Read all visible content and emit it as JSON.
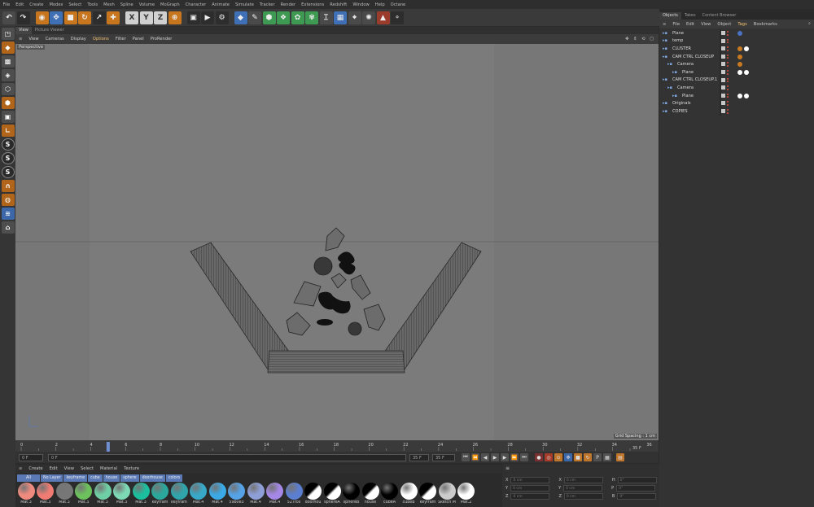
{
  "menubar": [
    "File",
    "Edit",
    "Create",
    "Modes",
    "Select",
    "Tools",
    "Mesh",
    "Spline",
    "Volume",
    "MoGraph",
    "Character",
    "Animate",
    "Simulate",
    "Tracker",
    "Render",
    "Extensions",
    "Redshift",
    "Window",
    "Help",
    "Octane"
  ],
  "view_tabs": [
    "View",
    "Picture Viewer"
  ],
  "view_menu": [
    "View",
    "Cameras",
    "Display",
    "Options",
    "Filter",
    "Panel",
    "ProRender"
  ],
  "viewport": {
    "label": "Perspective",
    "grid_spacing": "Grid Spacing : 1 cm"
  },
  "timeline": {
    "ticks": [
      "0",
      "2",
      "4",
      "6",
      "8",
      "10",
      "12",
      "14",
      "16",
      "18",
      "20",
      "22",
      "24",
      "26",
      "28",
      "30",
      "32",
      "34",
      "36"
    ],
    "end_field": "35 F",
    "current_frame": "5"
  },
  "transport": {
    "start": "0 F",
    "current": "0 F",
    "end": "35 F",
    "end2": "35 F"
  },
  "toolbar_axes": [
    "X",
    "Y",
    "Z"
  ],
  "material_menu": [
    "Create",
    "Edit",
    "View",
    "Select",
    "Material",
    "Texture"
  ],
  "material_tabs": [
    "All",
    "No Layer",
    "keyframe",
    "cube",
    "house",
    "sphere",
    "doorhouse",
    "colors"
  ],
  "materials": [
    {
      "label": "Mat.3",
      "color": "#ef8a7e"
    },
    {
      "label": "Mat.3",
      "color": "#f07b73"
    },
    {
      "label": "Mat.3",
      "color": "#777777"
    },
    {
      "label": "Mat.3",
      "color": "#6cc15d"
    },
    {
      "label": "Mat.3",
      "color": "#6fcfa4"
    },
    {
      "label": "Mat.3",
      "color": "#7dd8b5"
    },
    {
      "label": "Mat.3",
      "color": "#1bbf9d"
    },
    {
      "label": "keyfram",
      "color": "#2aa89c"
    },
    {
      "label": "keyfram",
      "color": "#2fa4aa"
    },
    {
      "label": "Mat.4",
      "color": "#37a8c8"
    },
    {
      "label": "Mat.4",
      "color": "#3aa9e6"
    },
    {
      "label": "59b0e3",
      "color": "#55a2e6"
    },
    {
      "label": "Mat.4",
      "color": "#8e9fd8"
    },
    {
      "label": "Mat.4",
      "color": "#a587e6"
    },
    {
      "label": "527fce",
      "color": "#5b7ed0"
    },
    {
      "label": "doorhou",
      "color": "#ffffff"
    },
    {
      "label": "sphereA",
      "color": "#ffffff"
    },
    {
      "label": "sphereB",
      "color": "#000000"
    },
    {
      "label": "house",
      "color": "#ffffff"
    },
    {
      "label": "cubeA",
      "color": "#000000"
    },
    {
      "label": "cubeB",
      "color": "#ffffff"
    },
    {
      "label": "keyfram",
      "color": "#ffffff"
    },
    {
      "label": "Sketch M",
      "color": "#cccccc"
    },
    {
      "label": "Mat.2",
      "color": "#ffffff"
    }
  ],
  "coords": {
    "rows": [
      [
        "X",
        "0 cm",
        "X",
        "0 cm",
        "H",
        "0°"
      ],
      [
        "Y",
        "0 cm",
        "Y",
        "0 cm",
        "P",
        "0°"
      ],
      [
        "Z",
        "0 cm",
        "Z",
        "0 cm",
        "B",
        "0°"
      ]
    ]
  },
  "right_tabs": [
    "Objects",
    "Takes",
    "Content Browser"
  ],
  "right_menu": [
    "File",
    "Edit",
    "View",
    "Object",
    "Tags",
    "Bookmarks"
  ],
  "objects": [
    {
      "name": "Plane",
      "indent": 0
    },
    {
      "name": "temp",
      "indent": 0
    },
    {
      "name": "CLUSTER",
      "indent": 0
    },
    {
      "name": "CAM CTRL CLOSEUP",
      "indent": 0
    },
    {
      "name": "Camera",
      "indent": 1
    },
    {
      "name": "Plane",
      "indent": 2
    },
    {
      "name": "CAM CTRL CLOSEUP.1",
      "indent": 0
    },
    {
      "name": "Camera",
      "indent": 1
    },
    {
      "name": "Plane",
      "indent": 2
    },
    {
      "name": "Originals",
      "indent": 0
    },
    {
      "name": "COPIES",
      "indent": 0
    }
  ]
}
